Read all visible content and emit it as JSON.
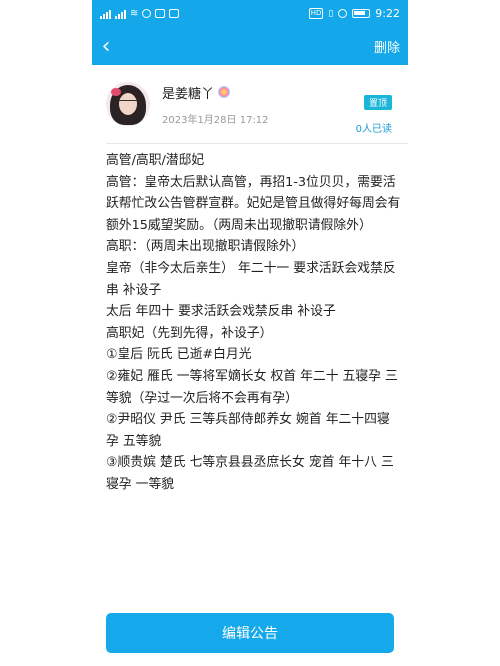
{
  "status_bar": {
    "time": "9:22",
    "hd_label": "HD"
  },
  "nav": {
    "back_icon": "chevron-left-icon",
    "delete_label": "删除"
  },
  "author": {
    "name": "是姜糖丫",
    "date": "2023年1月28日 17:12",
    "pin_label": "置顶",
    "read_count": "0人已读"
  },
  "content": {
    "lines": [
      "高管/高职/潜邸妃",
      "高管：皇帝太后默认高管，再招1-3位贝贝，需要活跃帮忙改公告管群宣群。妃妃是管且做得好每周会有额外15威望奖励。（两周未出现撤职请假除外）",
      "高职：（两周未出现撤职请假除外）",
      "皇帝（非今太后亲生） 年二十一 要求活跃会戏禁反串 补设子",
      "太后 年四十 要求活跃会戏禁反串 补设子",
      "高职妃（先到先得，补设子）",
      "①皇后 阮氏 已逝#白月光",
      "②雍妃 雁氏 一等将军嫡长女 权首 年二十 五寝孕 三等貌（孕过一次后将不会再有孕）",
      "②尹昭仪 尹氏 三等兵部侍郎养女 婉首 年二十四寝孕 五等貌",
      "③顺贵嫔 楚氏 七等京县县丞庶长女 宠首 年十八 三寝孕 一等貌"
    ]
  },
  "footer": {
    "edit_label": "编辑公告"
  },
  "colors": {
    "accent": "#14a8ea",
    "pin_badge": "#1ab5d8"
  }
}
